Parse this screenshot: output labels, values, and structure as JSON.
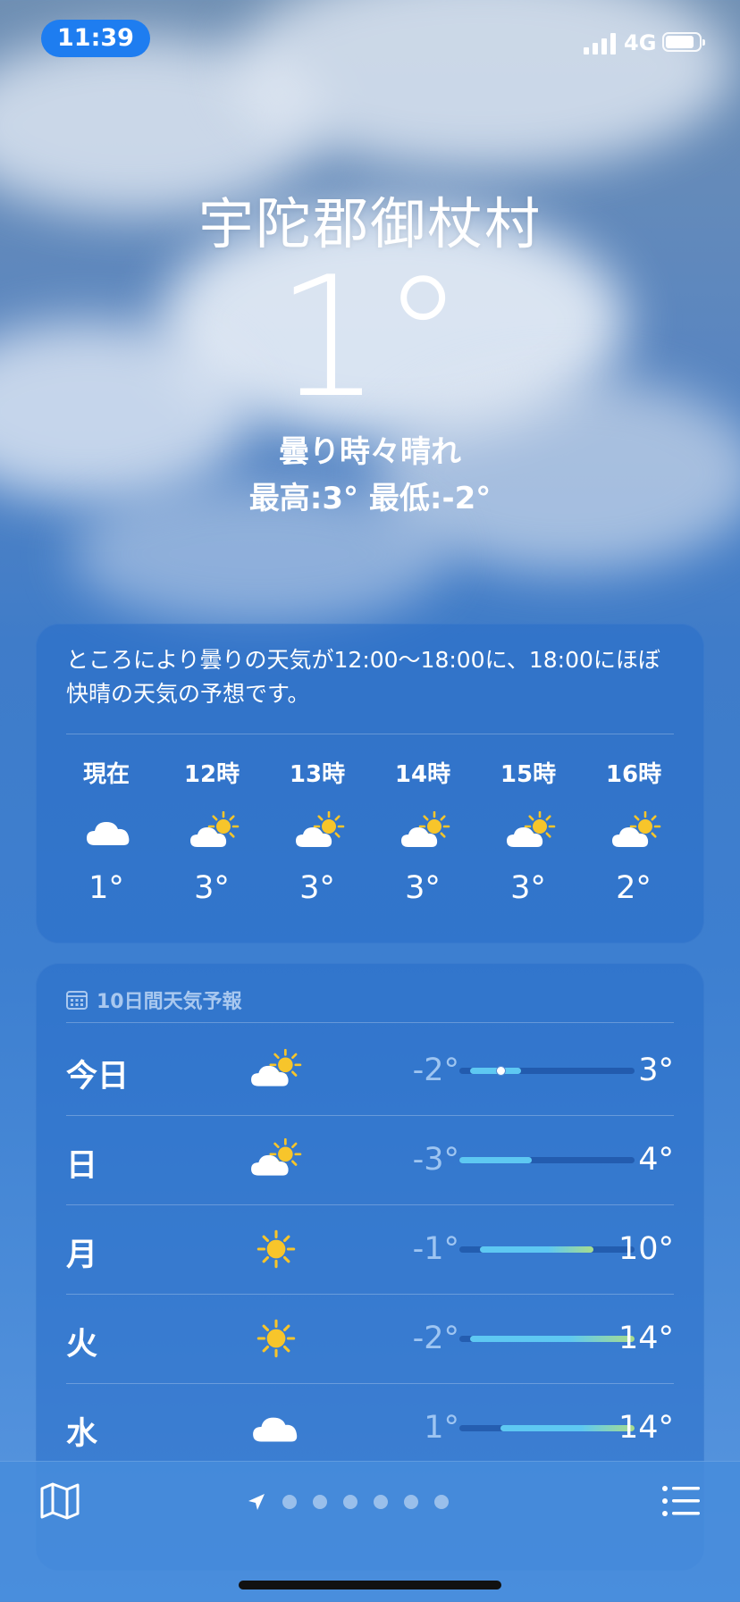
{
  "status": {
    "time": "11:39",
    "network": "4G",
    "battery_level": 0.85
  },
  "location": {
    "city": "宇陀郡御杖村",
    "temperature": "1°",
    "condition": "曇り時々晴れ",
    "high_low": "最高:3°  最低:-2°"
  },
  "hourly": {
    "summary": "ところにより曇りの天気が12:00～18:00に、18:00にほぼ快晴の天気の予想です。",
    "items": [
      {
        "label": "現在",
        "icon": "cloud-icon",
        "temp": "1°"
      },
      {
        "label": "12時",
        "icon": "partly-sunny-icon",
        "temp": "3°"
      },
      {
        "label": "13時",
        "icon": "partly-sunny-icon",
        "temp": "3°"
      },
      {
        "label": "14時",
        "icon": "partly-sunny-icon",
        "temp": "3°"
      },
      {
        "label": "15時",
        "icon": "partly-sunny-icon",
        "temp": "3°"
      },
      {
        "label": "16時",
        "icon": "partly-sunny-icon",
        "temp": "2°"
      }
    ]
  },
  "daily": {
    "header": "10日間天気予報",
    "range_min": -3,
    "range_max": 14,
    "current_temp": 1,
    "days": [
      {
        "name": "今日",
        "icon": "partly-sunny-icon",
        "low": "-2°",
        "high": "3°",
        "low_val": -2,
        "high_val": 3,
        "show_current": true
      },
      {
        "name": "日",
        "icon": "partly-sunny-icon",
        "low": "-3°",
        "high": "4°",
        "low_val": -3,
        "high_val": 4,
        "show_current": false
      },
      {
        "name": "月",
        "icon": "sun-icon",
        "low": "-1°",
        "high": "10°",
        "low_val": -1,
        "high_val": 10,
        "show_current": false
      },
      {
        "name": "火",
        "icon": "sun-icon",
        "low": "-2°",
        "high": "14°",
        "low_val": -2,
        "high_val": 14,
        "show_current": false
      },
      {
        "name": "水",
        "icon": "cloud-icon",
        "low": "1°",
        "high": "14°",
        "low_val": 1,
        "high_val": 14,
        "show_current": false
      }
    ]
  },
  "pager": {
    "page_count": 7,
    "current_index": 0
  },
  "colors": {
    "pill": "#1e7df0",
    "bar_cold": "#5ec8f2",
    "bar_warm": "#a8dc8c",
    "sun": "#f7c52b"
  }
}
